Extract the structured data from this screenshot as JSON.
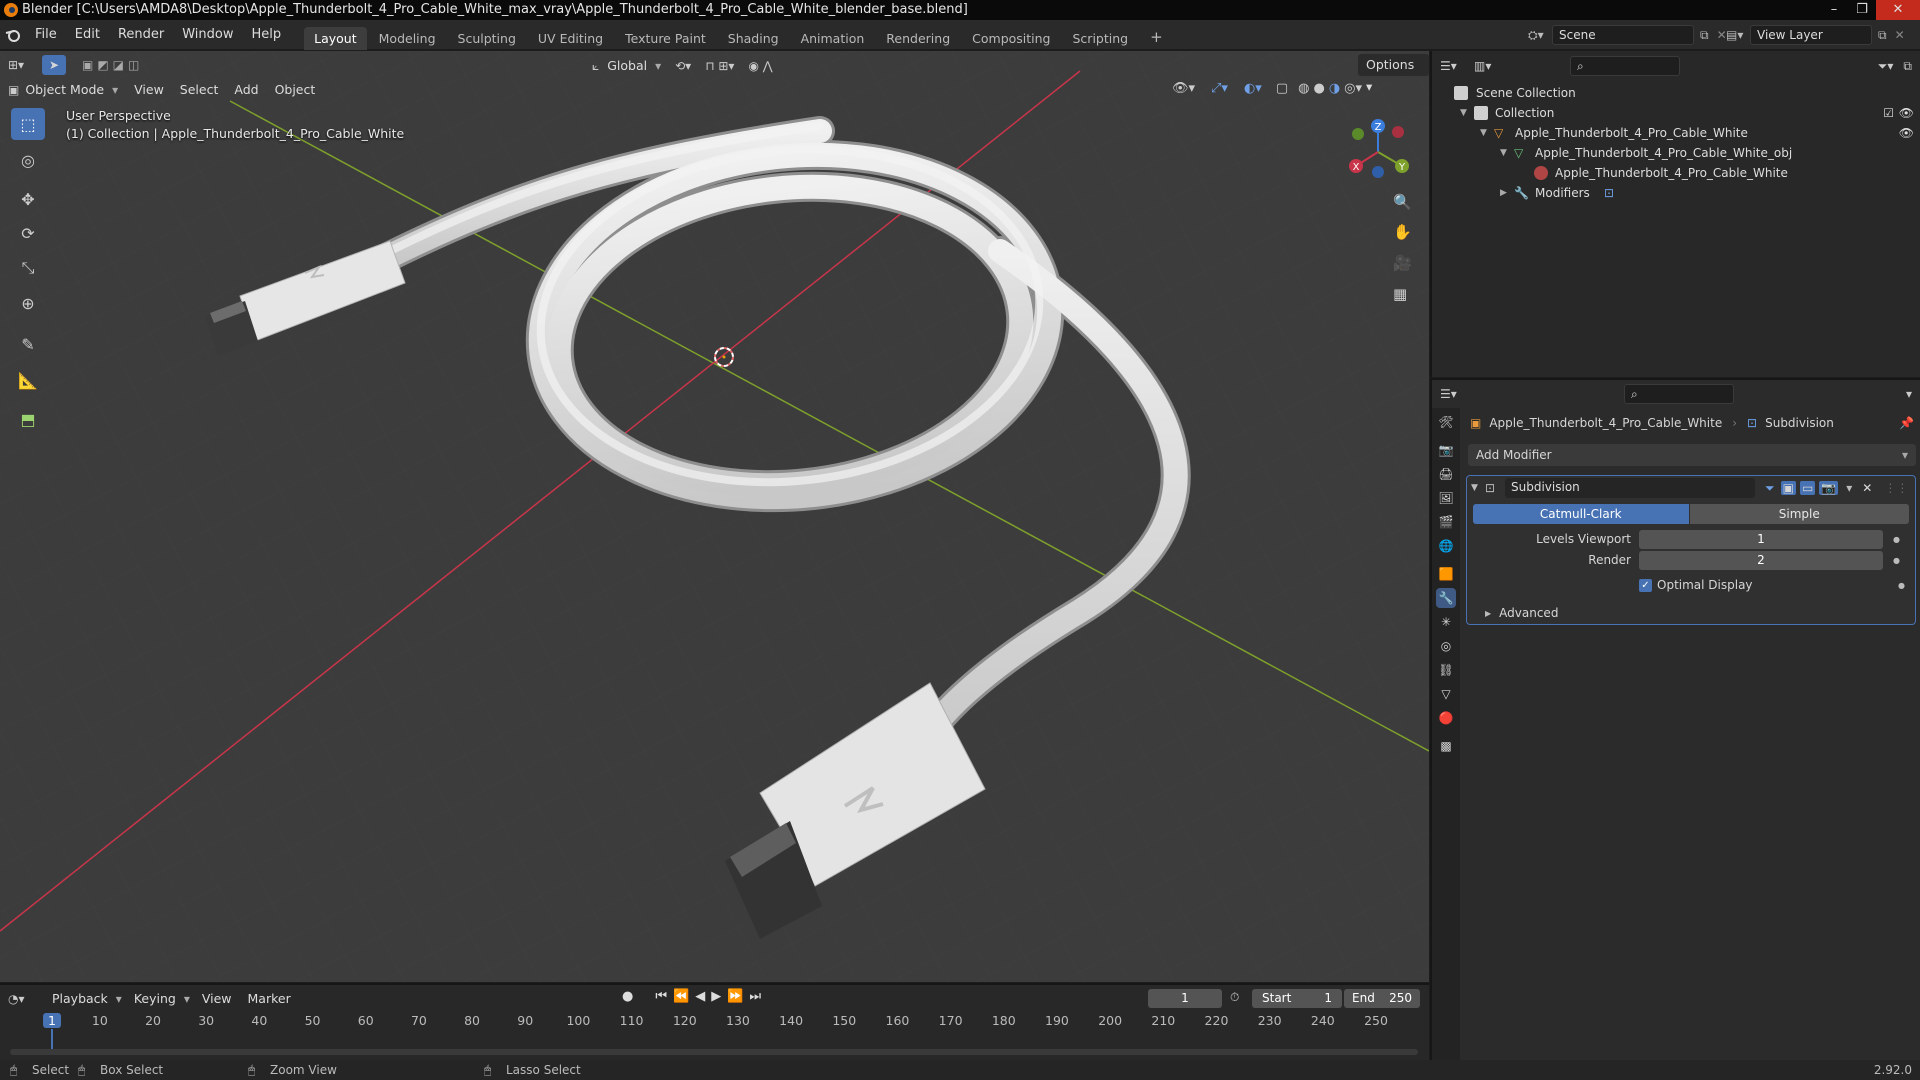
{
  "window": {
    "title": "Blender [C:\\Users\\AMDA8\\Desktop\\Apple_Thunderbolt_4_Pro_Cable_White_max_vray\\Apple_Thunderbolt_4_Pro_Cable_White_blender_base.blend]",
    "minimize": "–",
    "maximize": "❐",
    "close": "✕"
  },
  "menu": [
    "File",
    "Edit",
    "Render",
    "Window",
    "Help"
  ],
  "workspaces": [
    "Layout",
    "Modeling",
    "Sculpting",
    "UV Editing",
    "Texture Paint",
    "Shading",
    "Animation",
    "Rendering",
    "Compositing",
    "Scripting"
  ],
  "workspace_add": "+",
  "scene": {
    "label": "Scene",
    "view_layer": "View Layer"
  },
  "tool_header": {
    "orientation": "Global",
    "options": "Options"
  },
  "viewport_header": {
    "mode": "Object Mode",
    "menus": [
      "View",
      "Select",
      "Add",
      "Object"
    ]
  },
  "viewport_overlay": {
    "perspective": "User Perspective",
    "collection": "(1) Collection | Apple_Thunderbolt_4_Pro_Cable_White"
  },
  "gizmo": {
    "x": "X",
    "y": "Y",
    "z": "Z"
  },
  "outliner": {
    "root": "Scene Collection",
    "collection": "Collection",
    "object": "Apple_Thunderbolt_4_Pro_Cable_White",
    "mesh": "Apple_Thunderbolt_4_Pro_Cable_White_obj",
    "material": "Apple_Thunderbolt_4_Pro_Cable_White",
    "modifiers": "Modifiers"
  },
  "properties": {
    "object_name": "Apple_Thunderbolt_4_Pro_Cable_White",
    "modifier_breadcrumb": "Subdivision",
    "add_modifier": "Add Modifier",
    "modifier": {
      "name": "Subdivision",
      "types": [
        "Catmull-Clark",
        "Simple"
      ],
      "active_type": "Catmull-Clark",
      "levels_viewport_label": "Levels Viewport",
      "levels_viewport": "1",
      "render_label": "Render",
      "render": "2",
      "optimal_display_label": "Optimal Display",
      "optimal_display": true,
      "advanced": "Advanced"
    }
  },
  "timeline": {
    "menus": [
      "Playback",
      "Keying",
      "View",
      "Marker"
    ],
    "current_frame": "1",
    "start_label": "Start",
    "start": "1",
    "end_label": "End",
    "end": "250",
    "ticks": [
      "1",
      "10",
      "20",
      "30",
      "40",
      "50",
      "60",
      "70",
      "80",
      "90",
      "100",
      "110",
      "120",
      "130",
      "140",
      "150",
      "160",
      "170",
      "180",
      "190",
      "200",
      "210",
      "220",
      "230",
      "240",
      "250"
    ]
  },
  "statusbar": {
    "select": "Select",
    "box_select": "Box Select",
    "zoom_view": "Zoom View",
    "lasso_select": "Lasso Select",
    "version": "2.92.0"
  },
  "colors": {
    "accent": "#4772b3",
    "x_axis": "#c8354a",
    "y_axis": "#7ea12b",
    "z_axis": "#3b7ddd",
    "cable": "#e2e2e2",
    "viewport_bg": "#3c3c3c"
  }
}
